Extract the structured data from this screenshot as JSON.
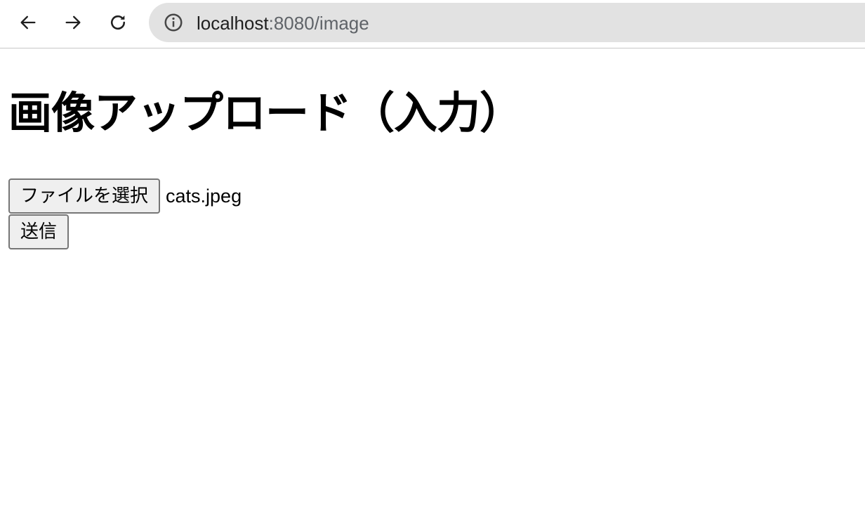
{
  "browser": {
    "url_host": "localhost",
    "url_rest": ":8080/image",
    "icons": {
      "back": "arrow-left-icon",
      "forward": "arrow-right-icon",
      "reload": "reload-icon",
      "info": "info-icon"
    },
    "omnibox_color": "#e2e2e2"
  },
  "page": {
    "title": "画像アップロード（入力）",
    "file_input": {
      "button_label": "ファイルを選択",
      "selected_file": "cats.jpeg"
    },
    "submit_label": "送信"
  }
}
